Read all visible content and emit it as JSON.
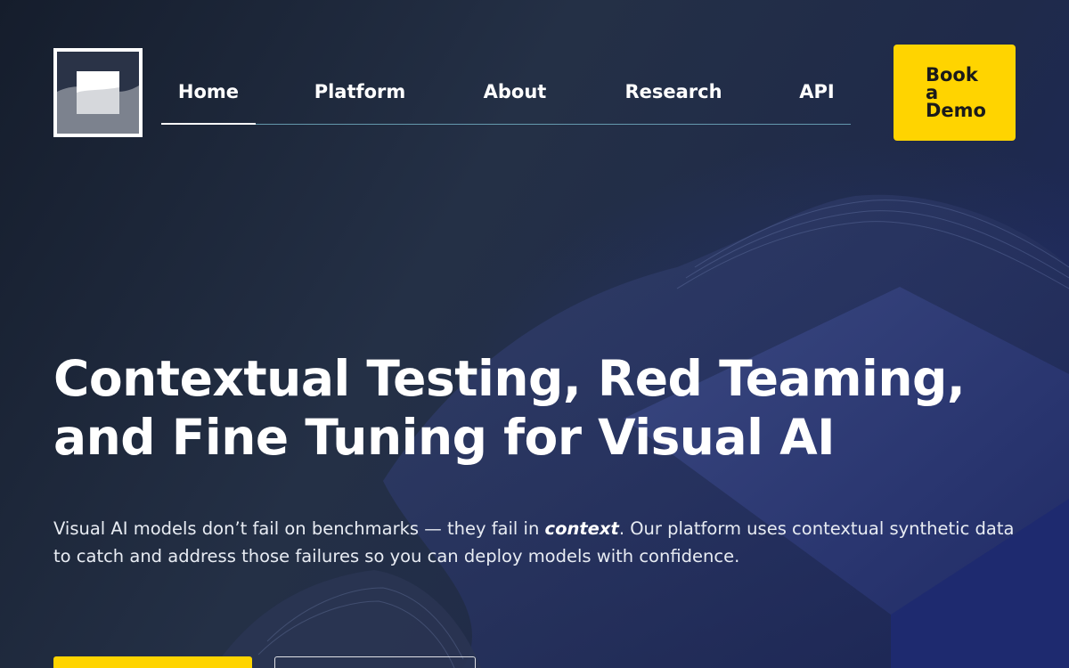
{
  "nav": {
    "items": [
      {
        "label": "Home",
        "active": true
      },
      {
        "label": "Platform"
      },
      {
        "label": "About"
      },
      {
        "label": "Research"
      },
      {
        "label": "API"
      }
    ]
  },
  "header": {
    "cta_label": "Book\na\nDemo"
  },
  "hero": {
    "headline": "Contextual Testing, Red Teaming, and Fine Tuning for Visual AI",
    "sub_before": "Visual AI models don’t fail on benchmarks — they fail in ",
    "sub_emphasis": "context",
    "sub_after": ". Our platform uses contextual synthetic data to catch and address those failures so you can deploy models with confidence."
  },
  "colors": {
    "accent": "#ffd400",
    "nav_underline": "#82c8dc"
  },
  "icons": {
    "logo": "square-wave-logo-icon"
  }
}
